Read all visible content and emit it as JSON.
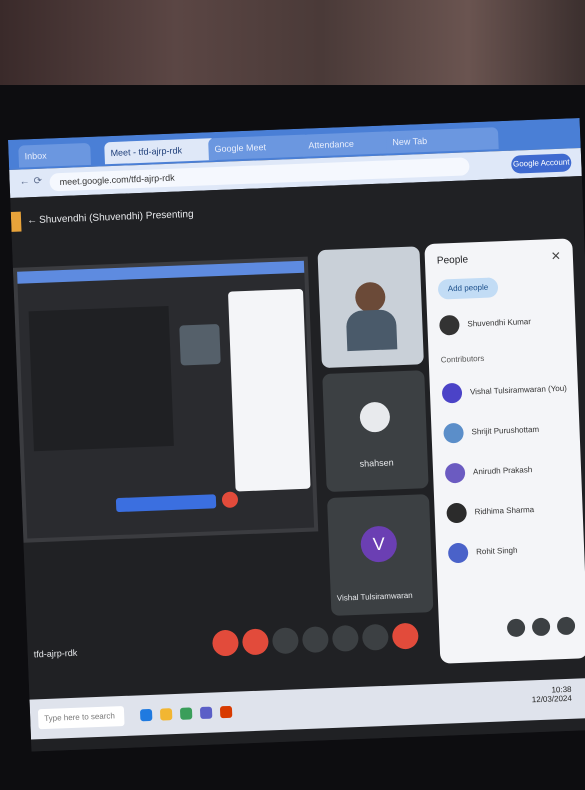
{
  "browser": {
    "tabs": [
      {
        "label": "Inbox"
      },
      {
        "label": "Meet - tfd-ajrp-rdk",
        "active": true
      },
      {
        "label": "Google Meet"
      },
      {
        "label": "Attendance"
      },
      {
        "label": "New Tab"
      }
    ],
    "url": "meet.google.com/tfd-ajrp-rdk",
    "profile_label": "Google Account"
  },
  "meeting": {
    "title": "Shuvendhi (Shuvendhi) Presenting",
    "code": "tfd-ajrp-rdk",
    "participants": [
      {
        "name": "",
        "role": "self-view"
      },
      {
        "name": "shahsen",
        "role": "tile"
      },
      {
        "name": "Vishal Tulsiramwaran",
        "initial": "V",
        "role": "tile"
      }
    ]
  },
  "people_panel": {
    "heading": "People",
    "add_label": "Add people",
    "host": "Shuvendhi Kumar",
    "section": "Contributors",
    "list": [
      {
        "name": "Vishal Tulsiramwaran (You)",
        "color": "#4b43c7",
        "initial": "V"
      },
      {
        "name": "Shrijit Purushottam",
        "color": "#5b8ec9",
        "initial": ""
      },
      {
        "name": "Anirudh Prakash",
        "color": "#6b5bc1",
        "initial": ""
      },
      {
        "name": "Ridhima Sharma",
        "color": "#2b2b2b",
        "initial": ""
      },
      {
        "name": "Rohit Singh",
        "color": "#4a62c9",
        "initial": "R"
      }
    ]
  },
  "taskbar": {
    "search_placeholder": "Type here to search",
    "time": "10:38",
    "date": "12/03/2024"
  }
}
